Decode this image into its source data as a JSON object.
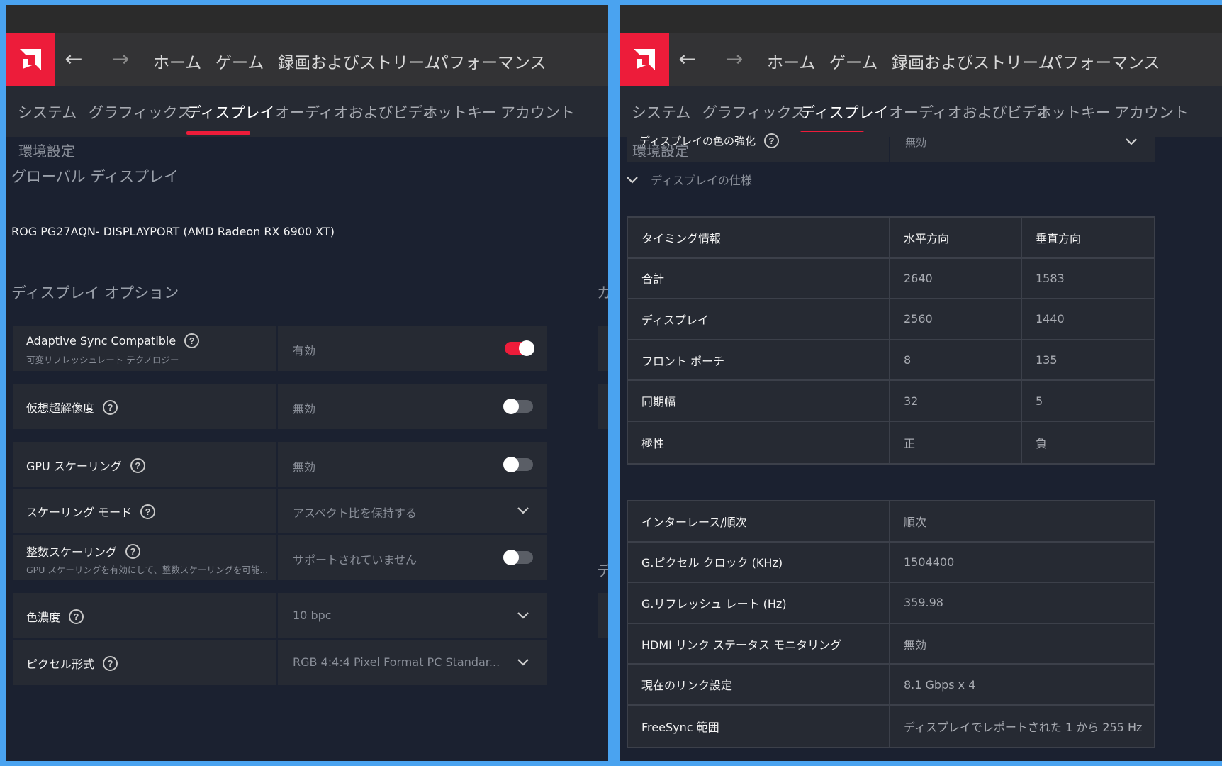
{
  "nav": {
    "back_icon": "arrow-left-icon",
    "forward_icon": "arrow-right-icon",
    "logo_icon": "amd-logo-icon",
    "items": [
      "ホーム",
      "ゲーム",
      "録画およびストリーム",
      "パフォーマンス"
    ]
  },
  "tabs": [
    "システム",
    "グラフィックス",
    "ディスプレイ",
    "オーディオおよびビデオ",
    "ホットキー",
    "アカウント"
  ],
  "active_tab": "ディスプレイ",
  "colors": {
    "accent": "#ed1c3a",
    "background": "#1b2130",
    "card": "#262a33"
  },
  "left": {
    "preferences_label": "環境設定",
    "global_display_label": "グローバル ディスプレイ",
    "monitor_name": "ROG PG27AQN- DISPLAYPORT (AMD Radeon RX 6900 XT)",
    "display_options_title": "ディスプレイ オプション",
    "edge_partial_1": "カ",
    "edge_partial_2": "デ",
    "options": [
      {
        "label": "Adaptive Sync Compatible",
        "sub": "可変リフレッシュレート テクノロジー",
        "value": "有効",
        "control": "toggle",
        "on": true
      },
      {
        "label": "仮想超解像度",
        "sub": "",
        "value": "無効",
        "control": "toggle",
        "on": false
      },
      {
        "label": "GPU スケーリング",
        "sub": "",
        "value": "無効",
        "control": "toggle",
        "on": false
      },
      {
        "label": "スケーリング モード",
        "sub": "",
        "value": "アスペクト比を保持する",
        "control": "dropdown"
      },
      {
        "label": "整数スケーリング",
        "sub": "GPU スケーリングを有効にして、整数スケーリングを可能...",
        "value": "サポートされていません",
        "control": "toggle",
        "on": false
      },
      {
        "label": "色濃度",
        "sub": "",
        "value": "10 bpc",
        "control": "dropdown"
      },
      {
        "label": "ピクセル形式",
        "sub": "",
        "value": "RGB 4:4:4 Pixel Format PC Standar...",
        "control": "dropdown"
      }
    ]
  },
  "right": {
    "color_enhance_label": "ディスプレイの色の強化",
    "color_enhance_value": "無効",
    "preferences_label": "環境設定",
    "spec_title": "ディスプレイの仕様",
    "timing_table": {
      "headers": [
        "タイミング情報",
        "水平方向",
        "垂直方向"
      ],
      "rows": [
        [
          "合計",
          "2640",
          "1583"
        ],
        [
          "ディスプレイ",
          "2560",
          "1440"
        ],
        [
          "フロント ポーチ",
          "8",
          "135"
        ],
        [
          "同期幅",
          "32",
          "5"
        ],
        [
          "極性",
          "正",
          "負"
        ]
      ]
    },
    "info_table": [
      [
        "インターレース/順次",
        "順次"
      ],
      [
        "G.ピクセル クロック (KHz)",
        "1504400"
      ],
      [
        "G.リフレッシュ レート (Hz)",
        "359.98"
      ],
      [
        "HDMI リンク ステータス モニタリング",
        "無効"
      ],
      [
        "現在のリンク設定",
        "8.1 Gbps x 4"
      ],
      [
        "FreeSync 範囲",
        "ディスプレイでレポートされた 1 から 255 Hz"
      ]
    ]
  }
}
